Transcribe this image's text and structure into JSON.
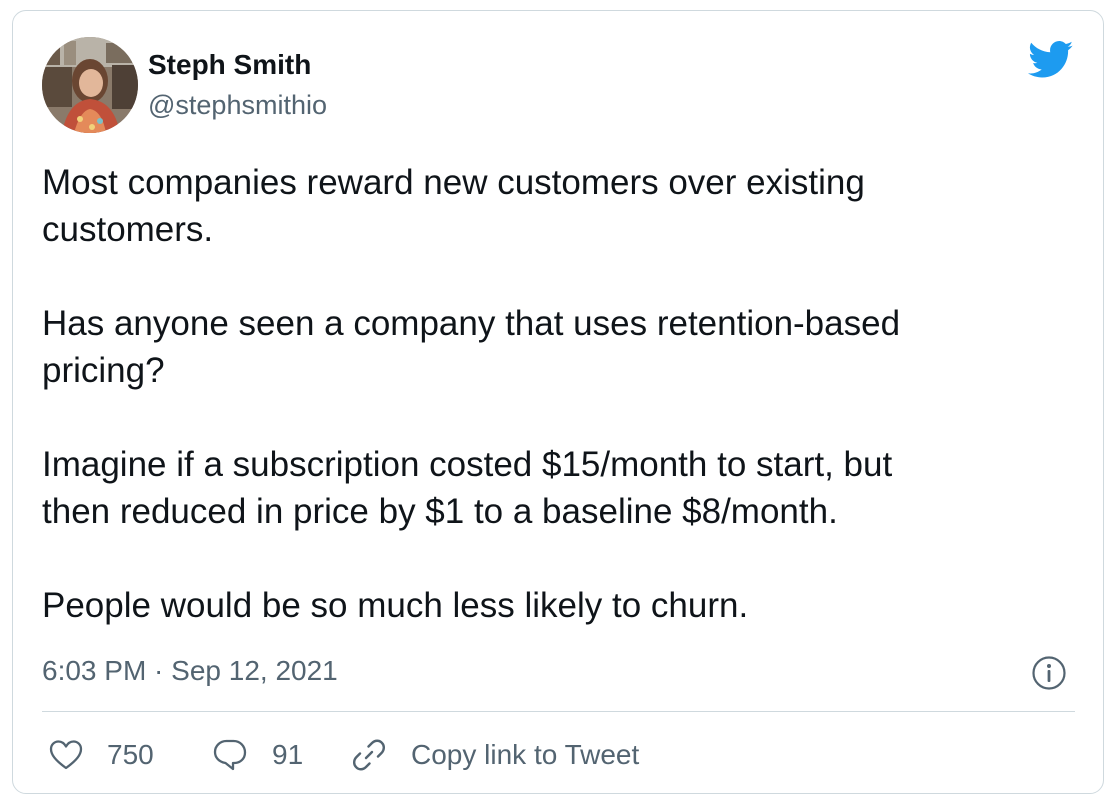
{
  "author": {
    "name": "Steph Smith",
    "handle": "@stephsmithio",
    "avatar_icon": "profile-photo"
  },
  "tweet": {
    "paragraphs": [
      "Most companies reward new customers over existing\ncustomers.",
      "Has anyone seen a company that uses retention-based\npricing?",
      "Imagine if a subscription costed $15/month to start, but\nthen reduced in price by $1 to a baseline $8/month.",
      "People would be so much less likely to churn."
    ],
    "timestamp": "6:03 PM · Sep 12, 2021"
  },
  "actions": {
    "like_count": "750",
    "reply_count": "91",
    "copy_link_label": "Copy link to Tweet"
  },
  "icons": {
    "brand": "twitter-bird-icon",
    "info": "info-icon",
    "like": "heart-icon",
    "reply": "reply-bubble-icon",
    "copy": "link-icon"
  },
  "colors": {
    "brand": "#1d9bf0",
    "text": "#0f1419",
    "muted": "#536471",
    "border": "#cfd9de"
  }
}
